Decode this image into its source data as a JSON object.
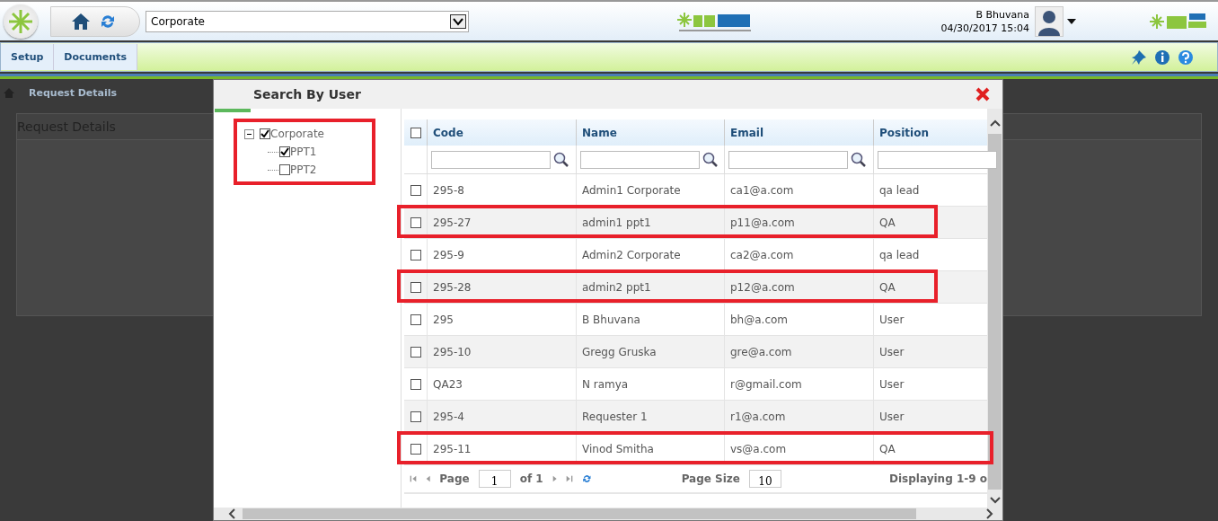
{
  "header": {
    "site": "Corporate",
    "user": "B Bhuvana",
    "datetime": "04/30/2017 15:04"
  },
  "menu": [
    {
      "label": "Setup",
      "selected": false
    },
    {
      "label": "Documents",
      "selected": false
    }
  ],
  "breadcrumb": "Request Details",
  "panel_title": "Request Details",
  "dialog": {
    "title": "Search By User",
    "tree": {
      "highlighted": true,
      "items": [
        {
          "label": "Corporate",
          "checked": true,
          "expanded": true,
          "children": [
            {
              "label": "PPT1",
              "checked": true
            },
            {
              "label": "PPT2",
              "checked": false
            }
          ]
        }
      ]
    },
    "select_all_checked": false,
    "columns": [
      "Code",
      "Name",
      "Email",
      "Position"
    ],
    "rows": [
      {
        "cells": [
          "295-8",
          "Admin1 Corporate",
          "ca1@a.com",
          "qa lead"
        ],
        "checked": false,
        "highlighted": false
      },
      {
        "cells": [
          "295-27",
          "admin1 ppt1",
          "p11@a.com",
          "QA"
        ],
        "checked": false,
        "highlighted": true
      },
      {
        "cells": [
          "295-9",
          "Admin2 Corporate",
          "ca2@a.com",
          "qa lead"
        ],
        "checked": false,
        "highlighted": false
      },
      {
        "cells": [
          "295-28",
          "admin2 ppt1",
          "p12@a.com",
          "QA"
        ],
        "checked": false,
        "highlighted": true
      },
      {
        "cells": [
          "295",
          "B Bhuvana",
          "bh@a.com",
          "User"
        ],
        "checked": false,
        "highlighted": false
      },
      {
        "cells": [
          "295-10",
          "Gregg Gruska",
          "gre@a.com",
          "User"
        ],
        "checked": false,
        "highlighted": false
      },
      {
        "cells": [
          "QA23",
          "N ramya",
          "r@gmail.com",
          "User"
        ],
        "checked": false,
        "highlighted": false
      },
      {
        "cells": [
          "295-4",
          "Requester 1",
          "r1@a.com",
          "User"
        ],
        "checked": false,
        "highlighted": false
      },
      {
        "cells": [
          "295-11",
          "Vinod Smitha",
          "vs@a.com",
          "QA"
        ],
        "checked": false,
        "highlighted": true
      }
    ],
    "pager": {
      "page_label": "Page",
      "page": "1",
      "of": "of 1",
      "size_label": "Page Size",
      "size": "10",
      "display": "Displaying 1-9 o"
    }
  }
}
